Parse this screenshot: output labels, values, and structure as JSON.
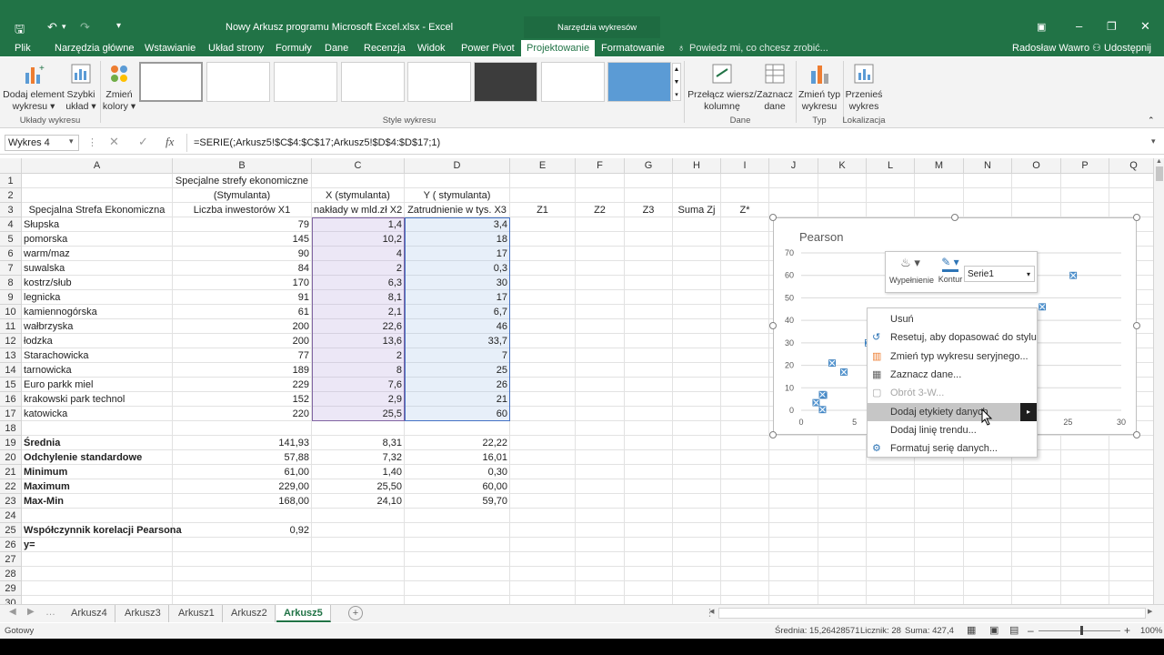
{
  "window": {
    "title": "Nowy Arkusz programu Microsoft Excel.xlsx - Excel",
    "context_tab": "Narzędzia wykresów",
    "user": "Radosław Wawro",
    "share": "Udostępnij"
  },
  "tabs": [
    {
      "label": "Plik"
    },
    {
      "label": "Narzędzia główne"
    },
    {
      "label": "Wstawianie"
    },
    {
      "label": "Układ strony"
    },
    {
      "label": "Formuły"
    },
    {
      "label": "Dane"
    },
    {
      "label": "Recenzja"
    },
    {
      "label": "Widok"
    },
    {
      "label": "Power Pivot"
    },
    {
      "label": "Projektowanie"
    },
    {
      "label": "Formatowanie"
    }
  ],
  "tellme": "Powiedz mi, co chcesz zrobić...",
  "ribbon": {
    "add_element": [
      "Dodaj element",
      "wykresu ▾"
    ],
    "quick_layout": [
      "Szybki",
      "układ ▾"
    ],
    "change_colors": [
      "Zmień",
      "kolory ▾"
    ],
    "group_layouts": "Układy wykresu",
    "group_styles": "Style wykresu",
    "switch_row": [
      "Przełącz wiersz/",
      "kolumnę"
    ],
    "select_data": [
      "Zaznacz",
      "dane"
    ],
    "group_data": "Dane",
    "change_type": [
      "Zmień typ",
      "wykresu"
    ],
    "group_type": "Typ",
    "move_chart": [
      "Przenieś",
      "wykres"
    ],
    "group_location": "Lokalizacja"
  },
  "formula_bar": {
    "name_box": "Wykres 4",
    "formula": "=SERIE(;Arkusz5!$C$4:$C$17;Arkusz5!$D$4:$D$17;1)"
  },
  "columns": [
    "A",
    "B",
    "C",
    "D",
    "E",
    "F",
    "G",
    "H",
    "I",
    "J",
    "K",
    "L",
    "M",
    "N",
    "O",
    "P",
    "Q"
  ],
  "rows": [
    "1",
    "2",
    "3",
    "4",
    "5",
    "6",
    "7",
    "8",
    "9",
    "10",
    "11",
    "12",
    "13",
    "14",
    "15",
    "16",
    "17",
    "18",
    "19",
    "20",
    "21",
    "22",
    "23",
    "24",
    "25",
    "26",
    "27",
    "28",
    "29",
    "30"
  ],
  "headers": {
    "b1": "Specjalne strefy ekonomiczne",
    "b2": "(Stymulanta)",
    "c2": "X (stymulanta)",
    "d2": "Y ( stymulanta)",
    "a3": "Specjalna Strefa Ekonomiczna",
    "b3": "Liczba inwestorów X1",
    "c3": "nakłady w mld.zł X2",
    "d3": "Zatrudnienie w tys.  X3",
    "e3": "Z1",
    "f3": "Z2",
    "g3": "Z3",
    "h3": "Suma Zj",
    "i3": "Z*"
  },
  "data_rows": [
    [
      "Słupska",
      "79",
      "1,4",
      "3,4"
    ],
    [
      "pomorska",
      "145",
      "10,2",
      "18"
    ],
    [
      "warm/maz",
      "90",
      "4",
      "17"
    ],
    [
      "suwalska",
      "84",
      "2",
      "0,3"
    ],
    [
      "kostrz/słub",
      "170",
      "6,3",
      "30"
    ],
    [
      "legnicka",
      "91",
      "8,1",
      "17"
    ],
    [
      "kamiennogórska",
      "61",
      "2,1",
      "6,7"
    ],
    [
      "wałbrzyska",
      "200",
      "22,6",
      "46"
    ],
    [
      "łodzka",
      "200",
      "13,6",
      "33,7"
    ],
    [
      "Starachowicka",
      "77",
      "2",
      "7"
    ],
    [
      "tarnowicka",
      "189",
      "8",
      "25"
    ],
    [
      "Euro parkk miel",
      "229",
      "7,6",
      "26"
    ],
    [
      "krakowski park technol",
      "152",
      "2,9",
      "21"
    ],
    [
      "katowicka",
      "220",
      "25,5",
      "60"
    ]
  ],
  "stats_rows": [
    [
      "Średnia",
      "141,93",
      "8,31",
      "22,22"
    ],
    [
      "Odchylenie standardowe",
      "57,88",
      "7,32",
      "16,01"
    ],
    [
      "Minimum",
      "61,00",
      "1,40",
      "0,30"
    ],
    [
      "Maximum",
      "229,00",
      "25,50",
      "60,00"
    ],
    [
      "Max-Min",
      "168,00",
      "24,10",
      "59,70"
    ]
  ],
  "pearson": {
    "label": "Współczynnik korelacji Pearsona",
    "value": "0,92"
  },
  "y_label": "y=",
  "chart": {
    "title": "Pearson",
    "y_ticks": [
      "70",
      "60",
      "50",
      "40",
      "30",
      "20",
      "10",
      "0"
    ],
    "x_ticks": [
      "0",
      "5",
      "25",
      "30"
    ]
  },
  "chart_data": {
    "type": "scatter",
    "title": "Pearson",
    "x": [
      1.4,
      10.2,
      4,
      2,
      6.3,
      8.1,
      2.1,
      22.6,
      13.6,
      2,
      8,
      7.6,
      2.9,
      25.5
    ],
    "y": [
      3.4,
      18,
      17,
      0.3,
      30,
      17,
      6.7,
      46,
      33.7,
      7,
      25,
      26,
      21,
      60
    ],
    "xlim": [
      0,
      30
    ],
    "ylim": [
      0,
      70
    ],
    "xlabel": "",
    "ylabel": "",
    "grid": true,
    "color": "#5b9bd5"
  },
  "mini_toolbar": {
    "fill": "Wypełnienie",
    "outline": "Kontur",
    "series": "Serie1"
  },
  "context_menu": [
    {
      "label": "Usuń",
      "state": "normal"
    },
    {
      "label": "Resetuj, aby dopasować do stylu",
      "state": "normal"
    },
    {
      "label": "Zmień typ wykresu seryjnego...",
      "state": "normal"
    },
    {
      "label": "Zaznacz dane...",
      "state": "normal"
    },
    {
      "label": "Obrót 3-W...",
      "state": "disabled"
    },
    {
      "label": "Dodaj etykiety danych",
      "state": "highlighted"
    },
    {
      "label": "Dodaj linię trendu...",
      "state": "normal"
    },
    {
      "label": "Formatuj serię danych...",
      "state": "normal"
    }
  ],
  "sheets": [
    "Arkusz4",
    "Arkusz3",
    "Arkusz1",
    "Arkusz2",
    "Arkusz5"
  ],
  "active_sheet": "Arkusz5",
  "status": {
    "ready": "Gotowy",
    "average": "Średnia: 15,26428571",
    "count": "Licznik: 28",
    "sum": "Suma: 427,4",
    "zoom": "100%"
  }
}
